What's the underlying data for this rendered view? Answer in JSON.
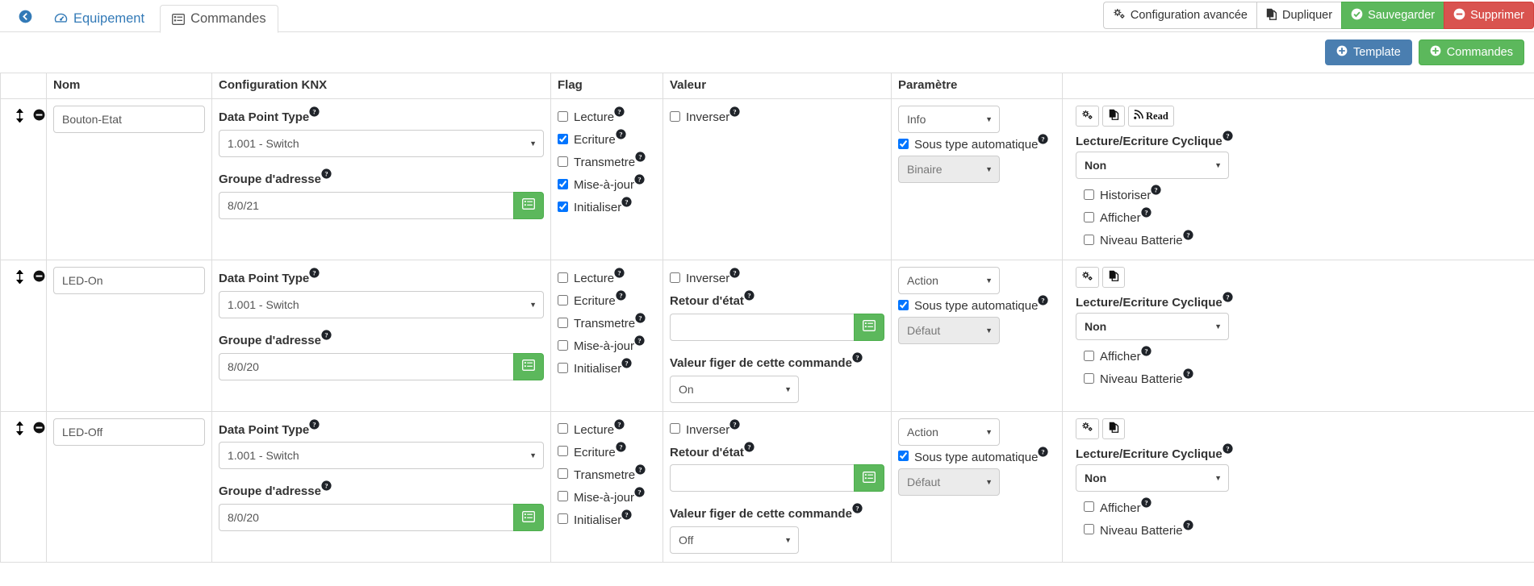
{
  "header": {
    "back_icon": "arrow-circle-left-icon",
    "tabs": [
      {
        "label": "Equipement",
        "icon": "dashboard-icon",
        "active": false
      },
      {
        "label": "Commandes",
        "icon": "list-alt-icon",
        "active": true
      }
    ],
    "actions": [
      {
        "label": "Configuration avancée",
        "icon": "cogs-icon",
        "style": "default"
      },
      {
        "label": "Dupliquer",
        "icon": "copy-icon",
        "style": "default"
      },
      {
        "label": "Sauvegarder",
        "icon": "check-circle-icon",
        "style": "green"
      },
      {
        "label": "Supprimer",
        "icon": "minus-circle-icon",
        "style": "red"
      }
    ]
  },
  "toolbar": {
    "template_label": "Template",
    "commandes_label": "Commandes",
    "plus_icon": "plus-circle-icon",
    "blue": "#4a7eb0",
    "green": "#5cb85c"
  },
  "table": {
    "columns": [
      "",
      "Nom",
      "Configuration KNX",
      "Flag",
      "Valeur",
      "Paramètre",
      ""
    ],
    "labels": {
      "data_point_type": "Data Point Type",
      "groupe_adresse": "Groupe d'adresse",
      "retour_etat": "Retour d'état",
      "valeur_figer": "Valeur figer de cette commande",
      "sous_type_auto": "Sous type automatique",
      "lecture_ecriture_cyclique": "Lecture/Ecriture Cyclique",
      "inverser": "Inverser",
      "historiser": "Historiser",
      "afficher": "Afficher",
      "niveau_batterie": "Niveau Batterie",
      "read_button": "Read"
    },
    "flag_names": [
      "Lecture",
      "Ecriture",
      "Transmetre",
      "Mise-à-jour",
      "Initialiser"
    ],
    "rows": [
      {
        "nom": "Bouton-Etat",
        "nom_placeholder": "Nom",
        "dpt": "1.001 - Switch",
        "groupe_adresse": "8/0/21",
        "flags": [
          false,
          true,
          false,
          true,
          true
        ],
        "inverser": false,
        "has_retour_etat": false,
        "retour_etat": "",
        "has_valeur_figer": false,
        "valeur_figer": "",
        "param_type": "Info",
        "sous_type_auto": true,
        "sous_type": "Binaire",
        "buttons": [
          "cogs-icon",
          "copy-icon",
          "Read"
        ],
        "has_read": true,
        "cyclique": "Non",
        "has_historiser": true,
        "historiser": false,
        "afficher": false,
        "niveau_batterie": false
      },
      {
        "nom": "LED-On",
        "nom_placeholder": "Nom",
        "dpt": "1.001 - Switch",
        "groupe_adresse": "8/0/20",
        "flags": [
          false,
          false,
          false,
          false,
          false
        ],
        "inverser": false,
        "has_retour_etat": true,
        "retour_etat": "",
        "has_valeur_figer": true,
        "valeur_figer": "On",
        "param_type": "Action",
        "sous_type_auto": true,
        "sous_type": "Défaut",
        "buttons": [
          "cogs-icon",
          "copy-icon"
        ],
        "has_read": false,
        "cyclique": "Non",
        "has_historiser": false,
        "historiser": false,
        "afficher": false,
        "niveau_batterie": false
      },
      {
        "nom": "LED-Off",
        "nom_placeholder": "Nom",
        "dpt": "1.001 - Switch",
        "groupe_adresse": "8/0/20",
        "flags": [
          false,
          false,
          false,
          false,
          false
        ],
        "inverser": false,
        "has_retour_etat": true,
        "retour_etat": "",
        "has_valeur_figer": true,
        "valeur_figer": "Off",
        "param_type": "Action",
        "sous_type_auto": true,
        "sous_type": "Défaut",
        "buttons": [
          "cogs-icon",
          "copy-icon"
        ],
        "has_read": false,
        "cyclique": "Non",
        "has_historiser": false,
        "historiser": false,
        "afficher": false,
        "niveau_batterie": false
      }
    ]
  },
  "icons": {
    "sort_handle": "arrows-v-icon",
    "remove_row": "minus-circle-icon",
    "list_picker": "list-alt-icon",
    "help": "question-circle-icon"
  }
}
